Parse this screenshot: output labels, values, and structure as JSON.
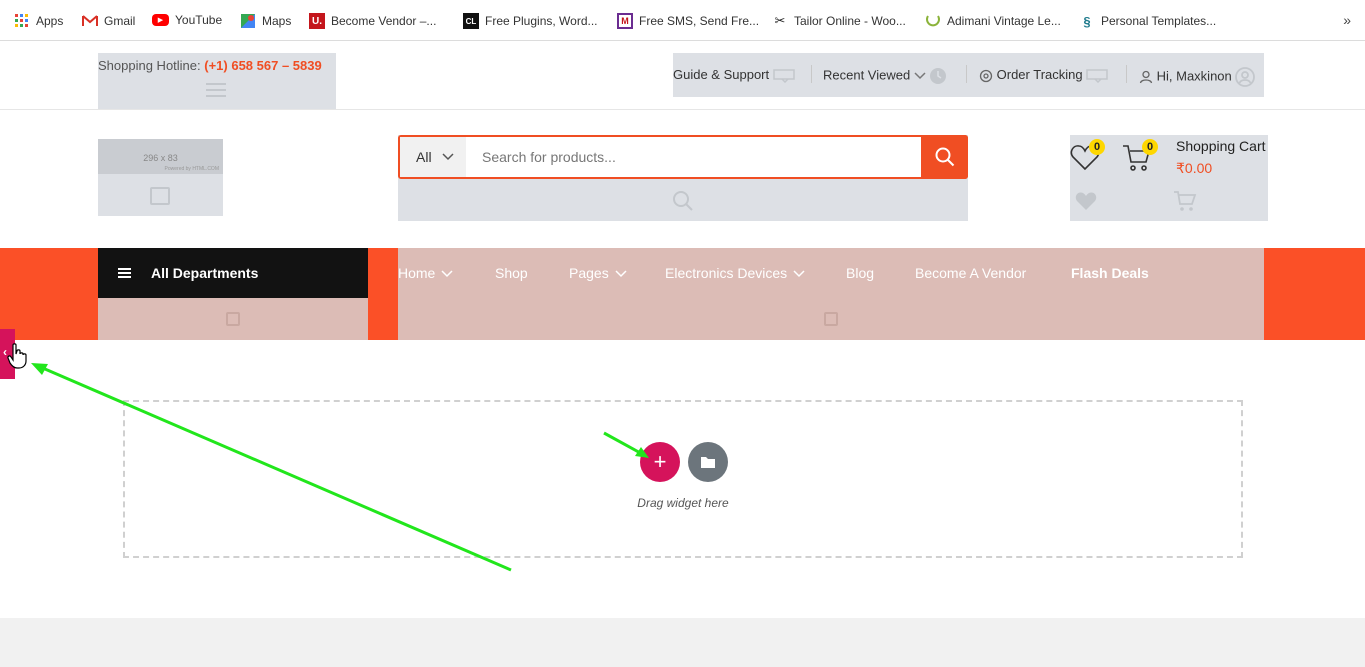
{
  "bookmarks": {
    "items": [
      {
        "label": "Apps",
        "icon": "apps-grid-icon"
      },
      {
        "label": "Gmail",
        "icon": "gmail-icon"
      },
      {
        "label": "YouTube",
        "icon": "youtube-icon"
      },
      {
        "label": "Maps",
        "icon": "maps-icon"
      },
      {
        "label": "Become Vendor –...",
        "icon": "u-logo-icon"
      },
      {
        "label": "Free Plugins, Word...",
        "icon": "cl-logo-icon"
      },
      {
        "label": "Free SMS, Send Fre...",
        "icon": "sms-logo-icon"
      },
      {
        "label": "Tailor Online - Woo...",
        "icon": "tailor-icon"
      },
      {
        "label": "Adimani Vintage Le...",
        "icon": "adimani-icon"
      },
      {
        "label": "Personal Templates...",
        "icon": "templates-icon"
      }
    ],
    "more": "»"
  },
  "topbar": {
    "hotline_label": "Shopping Hotline: ",
    "hotline_number": "(+1) 658 567 – 5839",
    "guide": "Guide & Support",
    "recent": "Recent Viewed",
    "tracking": "Order Tracking",
    "user": "Hi, Maxkinon"
  },
  "header": {
    "logo_placeholder": "296 x 83",
    "logo_powered": "Powered by HTML.COM",
    "search": {
      "category": "All",
      "placeholder": "Search for products..."
    },
    "wishlist_count": "0",
    "cart_count": "0",
    "cart_title": "Shopping Cart",
    "cart_price": "₹0.00"
  },
  "nav": {
    "departments": "All Departments",
    "menu": [
      {
        "label": "Home",
        "dropdown": true
      },
      {
        "label": "Shop",
        "dropdown": false
      },
      {
        "label": "Pages",
        "dropdown": true
      },
      {
        "label": "Electronics Devices",
        "dropdown": true
      },
      {
        "label": "Blog",
        "dropdown": false
      },
      {
        "label": "Become A Vendor",
        "dropdown": false
      },
      {
        "label": "Flash Deals",
        "dropdown": false
      }
    ]
  },
  "editor": {
    "add_symbol": "+",
    "drag_text": "Drag widget here",
    "panel_toggle": "‹"
  },
  "colors": {
    "accent": "#fb5027",
    "brand_magenta": "#d5135b",
    "badge_yellow": "#fed700",
    "annotation_arrow": "#22e61c"
  }
}
